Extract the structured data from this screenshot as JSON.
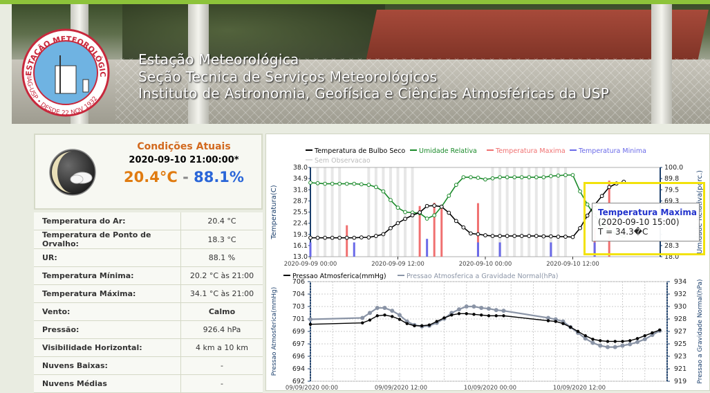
{
  "banner": {
    "line1": "Estação Meteorológica",
    "line2": "Seção Tecnica de Serviços Meteorológicos",
    "line3": "Instituto de Astronomia, Geofísica e Ciências Atmosféricas da USP",
    "logo_text_top": "ESTAÇÃO METEOROLÓGICA",
    "logo_text_bottom": "IAG-USP • DESDE 22 NOV 1932"
  },
  "conditions": {
    "title": "Condições Atuais",
    "datetime": "2020-09-10 21:00:00*",
    "temperature": "20.4°C",
    "separator": "-",
    "humidity": "88.1%",
    "icon": "partly-cloudy-night-icon"
  },
  "observations": [
    {
      "label": "Temperatura do Ar:",
      "value": "20.4 °C"
    },
    {
      "label": "Temperatura de Ponto de Orvalho:",
      "value": "18.3 °C"
    },
    {
      "label": "UR:",
      "value": "88.1 %"
    },
    {
      "label": "Temperatura Mínima:",
      "value": "20.2 °C às 21:00"
    },
    {
      "label": "Temperatura Máxima:",
      "value": "34.1 °C às 21:00"
    },
    {
      "label": "Vento:",
      "value": "Calmo"
    },
    {
      "label": "Pressão:",
      "value": "926.4 hPa"
    },
    {
      "label": "Visibilidade Horizontal:",
      "value": "4 km a 10 km"
    },
    {
      "label": "Nuvens Baixas:",
      "value": "-"
    },
    {
      "label": "Nuvens Médias",
      "value": "-"
    }
  ],
  "colors": {
    "temp": "#000000",
    "humidity": "#1a8a2a",
    "tmax": "#f07070",
    "tmin": "#6a6ae8",
    "nodata": "#dddddd",
    "pressure": "#000000",
    "pressure_normal": "#8a94a6",
    "accent_orange": "#e07b10",
    "accent_blue": "#2a66d8",
    "highlight": "#f2e20a"
  },
  "tooltip": {
    "title": "Temperatura Maxima",
    "date": "(2020-09-10 15:00)",
    "value": "T = 34.3�C"
  },
  "chart_data": [
    {
      "type": "line",
      "legend": [
        "Temperatura de Bulbo Seco",
        "Umidade Relativa",
        "Temperatura Maxima",
        "Temperatura Minima",
        "Sem Observacao"
      ],
      "ylabel": "Temperatura(C)",
      "y2label": "Umidade Relativa(porc.)",
      "yticks": [
        "38.0",
        "34.9",
        "31.8",
        "28.7",
        "25.5",
        "22.4",
        "19.3",
        "16.1",
        "13.0"
      ],
      "y2ticks": [
        "100.0",
        "89.8",
        "79.5",
        "69.3",
        "",
        "",
        "",
        "28.3",
        "18.0"
      ],
      "xticks": [
        "2020-09-09 00:00",
        "2020-09-09 12:00",
        "2020-09-10 00:00",
        "2020-09-10 12:00"
      ],
      "ylim": [
        13.0,
        38.0
      ],
      "y2lim": [
        18.0,
        100.0
      ],
      "xlim": [
        0,
        48
      ],
      "temperature": {
        "x": [
          0,
          1,
          2,
          3,
          4,
          5,
          6,
          7,
          8,
          9,
          10,
          11,
          12,
          13,
          14,
          15,
          16,
          17,
          18,
          19,
          20,
          21,
          22,
          23,
          24,
          25,
          26,
          27,
          28,
          29,
          30,
          31,
          32,
          33,
          34,
          35,
          36,
          37,
          38,
          39,
          40,
          41,
          42,
          43
        ],
        "y": [
          18.3,
          18.3,
          18.3,
          18.3,
          18.3,
          18.3,
          18.3,
          18.4,
          18.4,
          18.8,
          19.3,
          21.0,
          22.4,
          23.6,
          24.6,
          25.4,
          27.2,
          27.3,
          27.0,
          25.3,
          23.0,
          21.2,
          19.5,
          19.3,
          19.0,
          18.8,
          18.8,
          18.8,
          18.8,
          18.8,
          18.8,
          18.8,
          18.7,
          18.7,
          18.6,
          18.6,
          18.5,
          21.0,
          24.5,
          27.5,
          30.0,
          32.5,
          33.5,
          34.0
        ],
        "series_label": "Temperatura de Bulbo Seco"
      },
      "humidity": {
        "x": [
          0,
          1,
          2,
          3,
          4,
          5,
          6,
          7,
          8,
          9,
          10,
          11,
          12,
          13,
          14,
          15,
          16,
          17,
          18,
          19,
          20,
          21,
          22,
          23,
          24,
          25,
          26,
          27,
          28,
          29,
          30,
          31,
          32,
          33,
          34,
          35,
          36,
          37,
          38,
          39,
          40,
          41,
          42,
          43
        ],
        "y": [
          86.0,
          85.5,
          85.0,
          85.0,
          85.0,
          85.0,
          85.0,
          84.5,
          84.0,
          82.0,
          78.0,
          70.0,
          63.0,
          59.0,
          58.5,
          58.0,
          53.0,
          56.0,
          64.0,
          74.0,
          84.0,
          91.0,
          91.0,
          90.5,
          89.0,
          90.0,
          91.0,
          91.0,
          91.0,
          91.0,
          91.0,
          91.0,
          91.0,
          92.0,
          92.5,
          93.0,
          93.0,
          78.0,
          66.0,
          56.0,
          48.0,
          42.0,
          39.0,
          37.0
        ],
        "series_label": "Umidade Relativa"
      },
      "tmax_bars": {
        "x": [
          5,
          15,
          17,
          18,
          23,
          39,
          41
        ],
        "y": [
          21.8,
          27.2,
          28.1,
          27.0,
          28.0,
          21.0,
          34.3
        ]
      },
      "tmin_bars": {
        "x": [
          0,
          6,
          16,
          23,
          26,
          33,
          39
        ],
        "y": [
          17.0,
          17.0,
          18.0,
          17.0,
          17.0,
          17.0,
          17.0
        ]
      },
      "nodata_x": [
        1,
        2,
        3,
        4,
        8,
        9,
        10,
        11,
        12,
        13,
        14,
        25,
        26,
        27,
        28,
        29,
        30,
        31,
        32,
        33,
        34,
        35
      ]
    },
    {
      "type": "line",
      "legend": [
        "Pressao Atmosferica(mmHg)",
        "Pressao Atmosferica a Gravidade Normal(hPa)"
      ],
      "ylabel": "Pressao Atmosferica(mmHg)",
      "y2label": "Pressao a Gravidade Normal(hPa)",
      "yticks": [
        "706",
        "704",
        "703",
        "701",
        "699",
        "697",
        "696",
        "694",
        "692"
      ],
      "y2ticks": [
        "934",
        "932",
        "930",
        "928",
        "927",
        "925",
        "923",
        "921",
        "919"
      ],
      "xticks": [
        "09/09/2020 00:00",
        "09/09/2020 12:00",
        "10/09/2020 00:00",
        "10/09/2020 12:00"
      ],
      "ylim": [
        692,
        706
      ],
      "xlim": [
        0,
        48
      ],
      "pressure": {
        "x": [
          0,
          7,
          8,
          9,
          10,
          11,
          12,
          13,
          14,
          15,
          16,
          17,
          18,
          19,
          20,
          21,
          22,
          23,
          24,
          25,
          26,
          32,
          33,
          34,
          35,
          36,
          37,
          38,
          39,
          40,
          41,
          42,
          43,
          44,
          45,
          46,
          47
        ],
        "y": [
          700.0,
          700.2,
          700.6,
          701.2,
          701.3,
          701.1,
          700.7,
          700.1,
          699.8,
          699.8,
          699.9,
          700.4,
          700.9,
          701.3,
          701.5,
          701.5,
          701.4,
          701.3,
          701.2,
          701.2,
          701.2,
          700.5,
          700.4,
          700.1,
          699.6,
          699.0,
          698.4,
          697.9,
          697.7,
          697.6,
          697.6,
          697.6,
          697.7,
          698.0,
          698.4,
          698.8,
          699.2
        ],
        "series_label": "Pressao Atmosferica(mmHg)"
      },
      "pressure_normal": {
        "x": [
          0,
          7,
          8,
          9,
          10,
          11,
          12,
          13,
          14,
          15,
          16,
          17,
          18,
          19,
          20,
          21,
          22,
          23,
          24,
          25,
          26,
          32,
          33,
          34,
          35,
          36,
          37,
          38,
          39,
          40,
          41,
          42,
          43,
          44,
          45,
          46,
          47
        ],
        "y": [
          700.7,
          700.9,
          701.6,
          702.3,
          702.3,
          701.9,
          701.3,
          700.4,
          699.9,
          699.7,
          699.8,
          700.2,
          700.8,
          701.6,
          702.1,
          702.5,
          702.5,
          702.3,
          702.2,
          702.0,
          701.9,
          700.9,
          700.7,
          700.4,
          699.6,
          698.8,
          698.0,
          697.4,
          697.0,
          696.8,
          696.8,
          697.0,
          697.2,
          697.5,
          697.9,
          698.5,
          699.1
        ],
        "series_label": "Pressao Atmosferica a Gravidade Normal(hPa)"
      }
    }
  ]
}
